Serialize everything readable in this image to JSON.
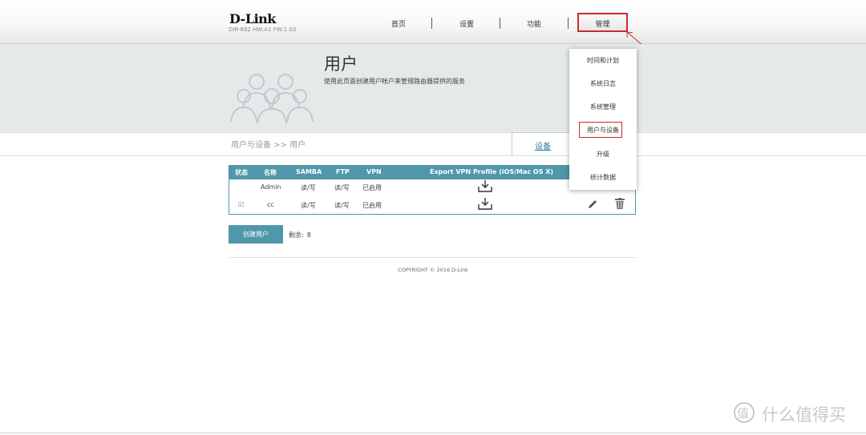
{
  "header": {
    "brand": "D-Link",
    "model": "DIR-882 HW:A1 FW:1.03",
    "nav": [
      "首页",
      "设置",
      "功能",
      "管理"
    ]
  },
  "banner": {
    "title": "用户",
    "description": "使用此页面创建用户帐户来管理路由器提供的服务"
  },
  "breadcrumb": "用户与设备 >> 用户",
  "tabs": {
    "devices": "设备"
  },
  "table": {
    "headers": [
      "状态",
      "名称",
      "SAMBA",
      "FTP",
      "VPN",
      "Export VPN Profile (iOS/Mac OS X)"
    ],
    "rows": [
      {
        "status": "",
        "name": "Admin",
        "samba": "读/写",
        "ftp": "读/写",
        "vpn": "已启用"
      },
      {
        "status": "☑",
        "name": "cc",
        "samba": "读/写",
        "ftp": "读/写",
        "vpn": "已启用"
      }
    ]
  },
  "actions": {
    "create_user": "创建用户",
    "remaining_label": "剩余:",
    "remaining_value": "8"
  },
  "footer": {
    "copyright": "COPYRIGHT © 2016 D-Link"
  },
  "dropdown": {
    "items": [
      "时间和计划",
      "系统日志",
      "系统管理",
      "用户与设备",
      "升级",
      "统计数据"
    ],
    "active_index": 3
  },
  "watermark": {
    "text": "什么值得买",
    "glyph": "值"
  },
  "icons": {
    "download": "download-icon",
    "edit": "pencil-icon",
    "delete": "trash-icon",
    "banner": "users-group-icon"
  },
  "colors": {
    "accent": "#4f97ab",
    "highlight": "#cc2a2a",
    "banner_bg": "#e5e9ea",
    "link": "#2a7fa0"
  }
}
